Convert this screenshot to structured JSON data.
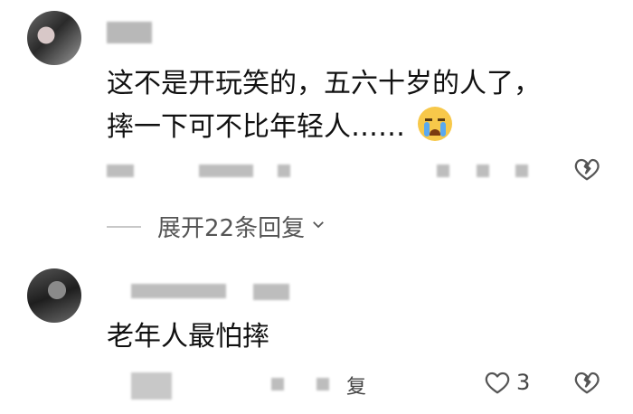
{
  "comments": [
    {
      "text_line1": "这不是开玩笑的，五六十岁的人了，",
      "text_line2": "摔一下可不比年轻人……",
      "emoji": "crying-face-emoji",
      "expand_label": "展开22条回复",
      "dislike_icon": "broken-heart-icon"
    },
    {
      "text": "老年人最怕摔",
      "like_icon": "heart-icon",
      "like_count": "3",
      "dislike_icon": "broken-heart-icon",
      "reply_fragment": "复"
    }
  ]
}
